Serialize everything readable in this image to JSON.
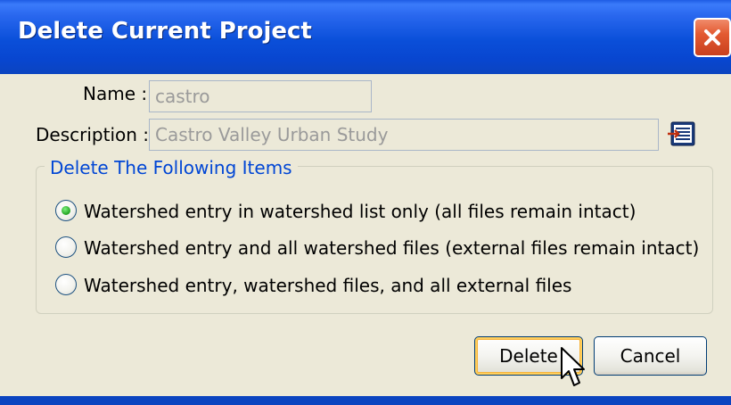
{
  "dialog": {
    "title": "Delete Current Project",
    "close_icon": "close-icon"
  },
  "form": {
    "name_label": "Name :",
    "name_value": "castro",
    "description_label": "Description :",
    "description_value": "Castro Valley Urban Study",
    "description_editor_icon": "text-editor-icon"
  },
  "group": {
    "title": "Delete The Following Items",
    "options": [
      {
        "label": "Watershed entry in watershed list only (all files remain intact)",
        "selected": true
      },
      {
        "label": "Watershed entry and all watershed files (external files remain intact)",
        "selected": false
      },
      {
        "label": "Watershed entry, watershed files, and all external files",
        "selected": false
      }
    ]
  },
  "buttons": {
    "delete": "Delete",
    "cancel": "Cancel"
  },
  "colors": {
    "titlebar": "#0a4fd9",
    "close": "#e35a32",
    "group_title": "#0046d5",
    "radio_selected": "#21a121",
    "disabled_text": "#9a9a9a"
  }
}
